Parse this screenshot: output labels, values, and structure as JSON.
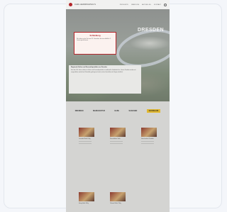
{
  "header": {
    "brand": "CARL HEINRICHPHIL'S",
    "nav": [
      "PRODUKTE",
      "ÜBER UNS",
      "AKTUELLES",
      "KONTAKT"
    ]
  },
  "hero": {
    "word": "DRESDEN"
  },
  "notice": {
    "title": "Schließung",
    "text": "Wir haben in der Zeit vom 23. Dezember bis einschließlich 2. Januar geschlossen."
  },
  "content": {
    "title": "Regionale Seifen und Kosmetikprodukte aus Dresden",
    "text": "Seit über 100 Jahren stellen wir Seifen und Kosmetikprodukte in traditioneller Handarbeit her. Unsere Produkte werden mit ausgewählten natürlichen Rohstoffen gefertigt und sind in vielen Geschäften der Region erhältlich."
  },
  "logos": [
    "DRESDEN",
    "MANUFAKTUR",
    "ELBE",
    "SACHSEN",
    "KAUFHAUS"
  ],
  "products": [
    {
      "title": "Lavendel Seife 100g"
    },
    {
      "title": "Rosenblüten Seife"
    },
    {
      "title": "Geschenkset Dresden"
    },
    {
      "title": "Honig Seife 100g"
    },
    {
      "title": "Olivenöl Seife 150g"
    }
  ]
}
